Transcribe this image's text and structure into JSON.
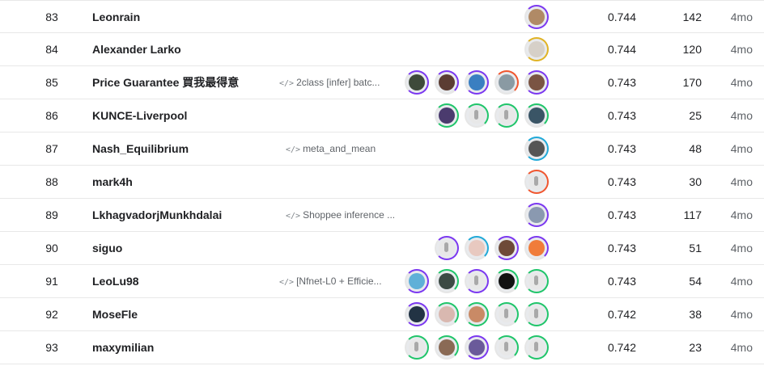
{
  "colors": {
    "tier_purple": "#7b38f0",
    "tier_orange": "#f0562f",
    "tier_green": "#20c56a",
    "tier_blue": "#20a9d8",
    "tier_gold": "#e0b325",
    "text_primary": "#202124",
    "text_secondary": "#5f6368"
  },
  "rows": [
    {
      "rank": "83",
      "team": "Leonrain",
      "notebook": "",
      "score": "0.744",
      "entries": "142",
      "last": "4mo",
      "avatars": [
        {
          "icon": "user-photo",
          "ring": "#7b38f0",
          "fill": "#b08a66"
        }
      ]
    },
    {
      "rank": "84",
      "team": "Alexander Larko",
      "notebook": "",
      "score": "0.744",
      "entries": "120",
      "last": "4mo",
      "avatars": [
        {
          "icon": "user-photo",
          "ring": "#e0b325",
          "fill": "#d6d0c8"
        }
      ]
    },
    {
      "rank": "85",
      "team": "Price Guarantee 買我最得意",
      "notebook": "2class [infer] batc...",
      "score": "0.743",
      "entries": "170",
      "last": "4mo",
      "avatars": [
        {
          "icon": "user-photo",
          "ring": "#7b38f0",
          "fill": "#3e4a3a"
        },
        {
          "icon": "user-photo",
          "ring": "#7b38f0",
          "fill": "#5b3d33"
        },
        {
          "icon": "user-photo",
          "ring": "#7b38f0",
          "fill": "#3a7fc1"
        },
        {
          "icon": "user-photo",
          "ring": "#f0562f",
          "fill": "#8a9aa3"
        },
        {
          "icon": "user-photo",
          "ring": "#7b38f0",
          "fill": "#7a5443"
        }
      ]
    },
    {
      "rank": "86",
      "team": "KUNCE-Liverpool",
      "notebook": "",
      "score": "0.743",
      "entries": "25",
      "last": "4mo",
      "avatars": [
        {
          "icon": "user-photo",
          "ring": "#20c56a",
          "fill": "#4b3b6e"
        },
        {
          "icon": "goose-avatar",
          "ring": "#20c56a",
          "fill": ""
        },
        {
          "icon": "goose-avatar",
          "ring": "#20c56a",
          "fill": ""
        },
        {
          "icon": "user-photo",
          "ring": "#20c56a",
          "fill": "#3a5566"
        }
      ]
    },
    {
      "rank": "87",
      "team": "Nash_Equilibrium",
      "notebook": "meta_and_mean",
      "score": "0.743",
      "entries": "48",
      "last": "4mo",
      "avatars": [
        {
          "icon": "user-photo",
          "ring": "#20a9d8",
          "fill": "#555555"
        }
      ]
    },
    {
      "rank": "88",
      "team": "mark4h",
      "notebook": "",
      "score": "0.743",
      "entries": "30",
      "last": "4mo",
      "avatars": [
        {
          "icon": "goose-avatar",
          "ring": "#f0562f",
          "fill": ""
        }
      ]
    },
    {
      "rank": "89",
      "team": "LkhagvadorjMunkhdalai",
      "notebook": "Shoppee inference ...",
      "score": "0.743",
      "entries": "117",
      "last": "4mo",
      "avatars": [
        {
          "icon": "user-photo",
          "ring": "#7b38f0",
          "fill": "#8a99b0"
        }
      ]
    },
    {
      "rank": "90",
      "team": "siguo",
      "notebook": "",
      "score": "0.743",
      "entries": "51",
      "last": "4mo",
      "avatars": [
        {
          "icon": "goose-avatar",
          "ring": "#7b38f0",
          "fill": ""
        },
        {
          "icon": "user-photo",
          "ring": "#20a9d8",
          "fill": "#e8c9c0"
        },
        {
          "icon": "user-photo",
          "ring": "#7b38f0",
          "fill": "#6e4a38"
        },
        {
          "icon": "user-photo",
          "ring": "#7b38f0",
          "fill": "#f07c3a"
        }
      ]
    },
    {
      "rank": "91",
      "team": "LeoLu98",
      "notebook": "[Nfnet-L0 + Efficie...",
      "score": "0.743",
      "entries": "54",
      "last": "4mo",
      "avatars": [
        {
          "icon": "user-photo",
          "ring": "#7b38f0",
          "fill": "#5fb0d8"
        },
        {
          "icon": "user-photo",
          "ring": "#20c56a",
          "fill": "#3c4a44"
        },
        {
          "icon": "goose-avatar",
          "ring": "#7b38f0",
          "fill": ""
        },
        {
          "icon": "user-photo",
          "ring": "#20c56a",
          "fill": "#111111"
        },
        {
          "icon": "goose-avatar",
          "ring": "#20c56a",
          "fill": ""
        }
      ]
    },
    {
      "rank": "92",
      "team": "MoseFle",
      "notebook": "",
      "score": "0.742",
      "entries": "38",
      "last": "4mo",
      "avatars": [
        {
          "icon": "user-photo",
          "ring": "#7b38f0",
          "fill": "#223344"
        },
        {
          "icon": "user-photo",
          "ring": "#20c56a",
          "fill": "#d9b8b0"
        },
        {
          "icon": "user-photo",
          "ring": "#20c56a",
          "fill": "#c98a66"
        },
        {
          "icon": "goose-avatar",
          "ring": "#20c56a",
          "fill": ""
        },
        {
          "icon": "goose-avatar",
          "ring": "#20c56a",
          "fill": ""
        }
      ]
    },
    {
      "rank": "93",
      "team": "maxymilian",
      "notebook": "",
      "score": "0.742",
      "entries": "23",
      "last": "4mo",
      "avatars": [
        {
          "icon": "goose-avatar",
          "ring": "#20c56a",
          "fill": ""
        },
        {
          "icon": "user-photo",
          "ring": "#20c56a",
          "fill": "#8a6a55"
        },
        {
          "icon": "user-photo",
          "ring": "#7b38f0",
          "fill": "#6a5a9a"
        },
        {
          "icon": "goose-avatar",
          "ring": "#20c56a",
          "fill": ""
        },
        {
          "icon": "goose-avatar",
          "ring": "#20c56a",
          "fill": ""
        }
      ]
    }
  ]
}
